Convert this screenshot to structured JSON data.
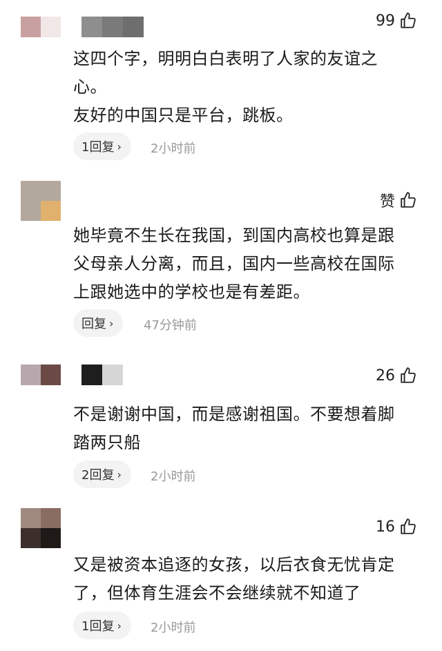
{
  "comments": [
    {
      "likes": "99",
      "text": "这四个字，明明白白表明了人家的友谊之\n心。\n友好的中国只是平台，跳板。",
      "reply_label": "1回复",
      "time": "2小时前"
    },
    {
      "likes": "赞",
      "text": "她毕竟不生长在我国，到国内高校也算是跟\n父母亲人分离，而且，国内一些高校在国际\n上跟她选中的学校也是有差距。",
      "reply_label": "回复",
      "time": "47分钟前"
    },
    {
      "likes": "26",
      "text": "不是谢谢中国，而是感谢祖国。不要想着脚\n踏两只船",
      "reply_label": "2回复",
      "time": "2小时前"
    },
    {
      "likes": "16",
      "text": "又是被资本追逐的女孩，以后衣食无忧肯定\n了，但体育生涯会不会继续就不知道了",
      "reply_label": "1回复",
      "time": "2小时前"
    }
  ],
  "icons": {
    "like": "thumbs-up-icon",
    "chevron": "chevron-right-icon"
  }
}
